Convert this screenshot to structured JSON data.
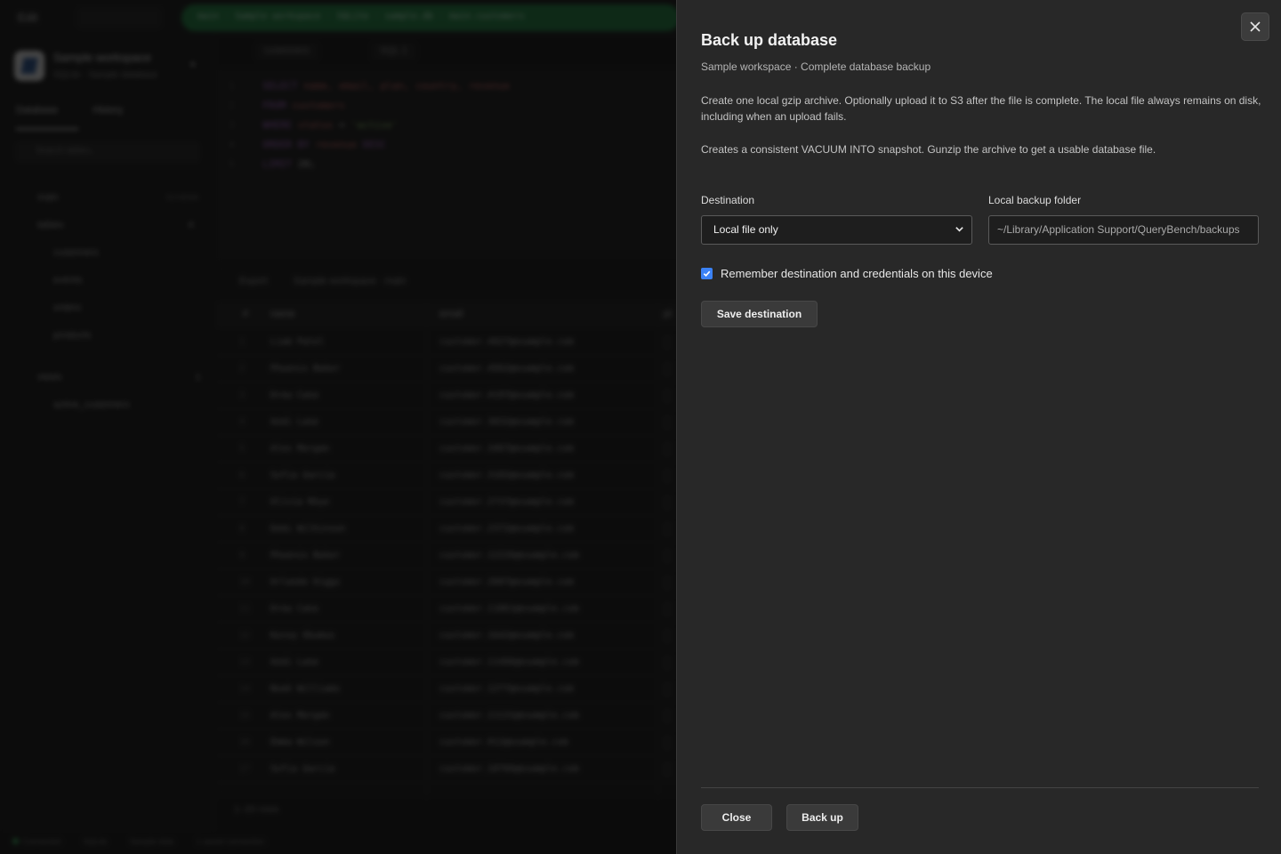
{
  "background_app": {
    "titlebar": {
      "edit_label": "Edit",
      "path": "main · Sample workspace · SQLite · sample.db · main.customers"
    },
    "sidebar": {
      "workspace_name": "Sample workspace",
      "workspace_sub": "SQLite · Sample database",
      "tabs": [
        "Database",
        "History"
      ],
      "search_placeholder": "Search tables...",
      "schema_label": "main",
      "schema_meta": "SCHEMA",
      "tables_label": "tables",
      "tables_count": "4",
      "tables": [
        "customers",
        "events",
        "orders",
        "products"
      ],
      "views_label": "views",
      "views_count": "1",
      "views": [
        "active_customers"
      ]
    },
    "editor": {
      "tabs": [
        "customers",
        "SQL 1"
      ],
      "code": [
        {
          "n": "1",
          "parts": [
            [
              "kw",
              "SELECT "
            ],
            [
              "id",
              "name, email, plan, country, revenue"
            ]
          ]
        },
        {
          "n": "2",
          "parts": [
            [
              "kw",
              "FROM "
            ],
            [
              "id",
              "customers"
            ]
          ]
        },
        {
          "n": "3",
          "parts": [
            [
              "kw",
              "WHERE "
            ],
            [
              "id",
              "status "
            ],
            [
              "plain",
              "= "
            ],
            [
              "str",
              "'active'"
            ]
          ]
        },
        {
          "n": "4",
          "parts": [
            [
              "kw",
              "ORDER BY "
            ],
            [
              "id",
              "revenue "
            ],
            [
              "kw",
              "DESC"
            ]
          ]
        },
        {
          "n": "5",
          "parts": [
            [
              "kw",
              "LIMIT "
            ],
            [
              "plain",
              "20;"
            ]
          ]
        }
      ]
    },
    "results": {
      "export_label": "Export",
      "context_label": "Sample workspace · main",
      "columns": [
        "#",
        "name",
        "email",
        "pl"
      ],
      "rows": [
        [
          "1",
          "Liam Patel",
          "customer.4927@example.com"
        ],
        [
          "2",
          "Phoenix Baker",
          "customer.4562@example.com"
        ],
        [
          "3",
          "Drew Cano",
          "customer.4197@example.com"
        ],
        [
          "4",
          "Andi Lane",
          "customer.3832@example.com"
        ],
        [
          "5",
          "Alex Morgan",
          "customer.3467@example.com"
        ],
        [
          "6",
          "Sofia Garcia",
          "customer.3102@example.com"
        ],
        [
          "7",
          "Olivia Rhye",
          "customer.2737@example.com"
        ],
        [
          "8",
          "Demi Wilkinson",
          "customer.2372@example.com"
        ],
        [
          "9",
          "Phoenix Baker",
          "customer.12226@example.com"
        ],
        [
          "10",
          "Orlando Diggs",
          "customer.2007@example.com"
        ],
        [
          "11",
          "Drew Cano",
          "customer.11861@example.com"
        ],
        [
          "12",
          "Kocey Okumus",
          "customer.1642@example.com"
        ],
        [
          "13",
          "Andi Lane",
          "customer.11496@example.com"
        ],
        [
          "14",
          "Noah Williams",
          "customer.1277@example.com"
        ],
        [
          "15",
          "Alex Morgan",
          "customer.11131@example.com"
        ],
        [
          "16",
          "Emma Wilson",
          "customer.912@example.com"
        ],
        [
          "17",
          "Sofia Garcia",
          "customer.10766@example.com"
        ]
      ],
      "footer": "1–20 rows"
    },
    "statusbar": [
      "Connected",
      "SQLite",
      "Sample data",
      "1 saved connection"
    ]
  },
  "dialog": {
    "title": "Back up database",
    "subtitle": "Sample workspace · Complete database backup",
    "description": "Create one local gzip archive. Optionally upload it to S3 after the file is complete. The local file always remains on disk, including when an upload fails.",
    "description2": "Creates a consistent VACUUM INTO snapshot. Gunzip the archive to get a usable database file.",
    "destination_label": "Destination",
    "destination_value": "Local file only",
    "folder_label": "Local backup folder",
    "folder_value": "~/Library/Application Support/QueryBench/backups",
    "remember_label": "Remember destination and credentials on this device",
    "remember_checked": true,
    "save_button": "Save destination",
    "close_button": "Close",
    "backup_button": "Back up",
    "icons": {
      "close": "close-icon",
      "select": "chevron-down-icon",
      "check": "check-icon"
    },
    "colors": {
      "panel": "#282828",
      "accent": "#3b82f6",
      "path_pill": "#1f7a3e"
    }
  }
}
